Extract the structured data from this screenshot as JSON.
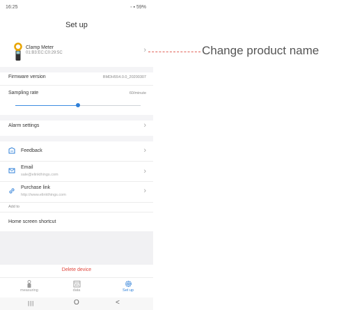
{
  "status_bar": {
    "time": "16:25",
    "battery": "59%"
  },
  "header": {
    "title": "Set up"
  },
  "device": {
    "name": "Clamp Meter",
    "mac": "01:B3:EC:C0:29:5C"
  },
  "firmware": {
    "label": "Firmware version",
    "value": "BMDH554.0.0_20200307"
  },
  "sampling": {
    "label": "Sampling rate",
    "value": "60/minute",
    "level_fraction": 0.5
  },
  "alarm": {
    "label": "Alarm settings"
  },
  "feedback": {
    "label": "Feedback"
  },
  "email": {
    "label": "Email",
    "value": "sale@elinkthings.com"
  },
  "purchase": {
    "label": "Purchase link",
    "value": "http://www.elinkthings.com"
  },
  "add_to": {
    "label": "Add to"
  },
  "shortcut": {
    "label": "Home screen shortcut"
  },
  "delete": {
    "label": "Delete device"
  },
  "tabs": [
    {
      "label": "measuring",
      "icon": "meter-icon"
    },
    {
      "label": "data",
      "icon": "calendar-icon"
    },
    {
      "label": "Set up",
      "icon": "gear-icon",
      "active": true
    }
  ],
  "nav": {
    "recent": "|||",
    "home": "O",
    "back": "<"
  },
  "callout": {
    "text": "Change product name"
  },
  "colors": {
    "accent": "#2e7fd8",
    "delete": "#e0463c",
    "callout_line": "#e06055"
  }
}
